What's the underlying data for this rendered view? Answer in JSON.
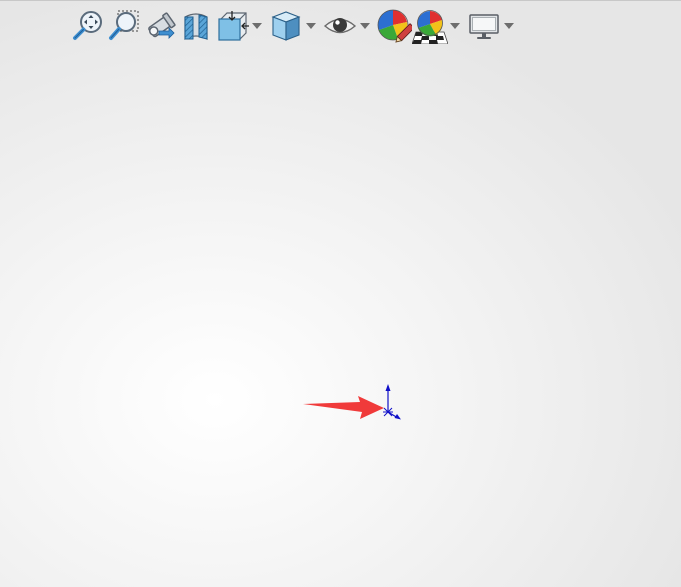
{
  "toolbar": {
    "buttons": [
      {
        "name": "zoom-to-fit",
        "icon": "zoom-to-fit-icon"
      },
      {
        "name": "zoom-to-area",
        "icon": "zoom-to-area-icon"
      },
      {
        "name": "previous-view",
        "icon": "previous-view-icon"
      },
      {
        "name": "section-view",
        "icon": "section-view-icon"
      },
      {
        "name": "view-orientation",
        "icon": "view-orientation-icon",
        "dropdown": true
      },
      {
        "name": "display-style",
        "icon": "display-style-icon",
        "dropdown": true
      },
      {
        "name": "hide-show-items",
        "icon": "eye-icon",
        "dropdown": true
      },
      {
        "name": "edit-appearance",
        "icon": "edit-appearance-icon"
      },
      {
        "name": "apply-scene",
        "icon": "apply-scene-icon",
        "dropdown": true
      },
      {
        "name": "view-settings",
        "icon": "monitor-icon",
        "dropdown": true
      }
    ]
  },
  "colors": {
    "pointer_arrow": "#f03a3a",
    "triad": "#1010c8",
    "viewport_center": "#ffffff",
    "viewport_edge": "#e6e6e6"
  }
}
